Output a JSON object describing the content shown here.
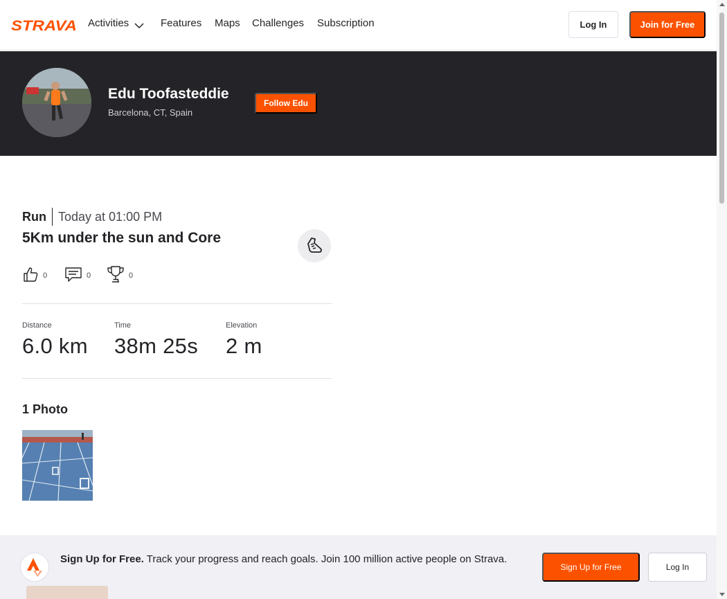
{
  "brand": {
    "name": "STRAVA",
    "color": "#fc5200"
  },
  "nav": {
    "items": [
      {
        "label": "Activities",
        "has_dropdown": true
      },
      {
        "label": "Features"
      },
      {
        "label": "Maps"
      },
      {
        "label": "Challenges"
      },
      {
        "label": "Subscription"
      }
    ],
    "login_label": "Log In",
    "join_label": "Join for Free"
  },
  "athlete": {
    "name": "Edu Toofasteddie",
    "location": "Barcelona, CT, Spain",
    "follow_label": "Follow Edu"
  },
  "activity": {
    "type": "Run",
    "date": "Today at 01:00 PM",
    "title": "5Km under the sun and Core",
    "sport_icon": "running-shoe-icon",
    "kudos": "0",
    "comments": "0",
    "achievements": "0",
    "stats": {
      "distance": {
        "label": "Distance",
        "value": "6.0 km"
      },
      "time": {
        "label": "Time",
        "value": "38m 25s"
      },
      "elevation": {
        "label": "Elevation",
        "value": "2 m"
      }
    },
    "photos_heading": "1 Photo"
  },
  "signup_bar": {
    "headline": "Sign Up for Free.",
    "text": "Track your progress and reach goals. Join 100 million active people on Strava.",
    "signup_label": "Sign Up for Free",
    "login_label": "Log In"
  }
}
